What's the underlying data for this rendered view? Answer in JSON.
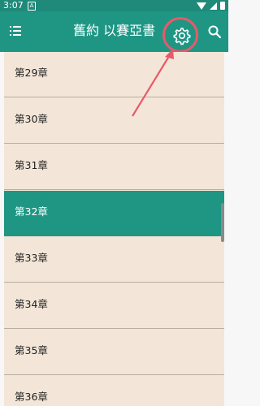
{
  "status_bar": {
    "time": "3:07",
    "notif_letter": "A"
  },
  "app_bar": {
    "title": "舊約 以賽亞書",
    "menu_icon": "menu-icon",
    "settings_icon": "gear-icon",
    "search_icon": "search-icon"
  },
  "chapters": [
    {
      "label": "第29章",
      "selected": false
    },
    {
      "label": "第30章",
      "selected": false
    },
    {
      "label": "第31章",
      "selected": false
    },
    {
      "label": "第32章",
      "selected": true
    },
    {
      "label": "第33章",
      "selected": false
    },
    {
      "label": "第34章",
      "selected": false
    },
    {
      "label": "第35章",
      "selected": false
    },
    {
      "label": "第36章",
      "selected": false
    }
  ],
  "colors": {
    "accent": "#1f9684",
    "list_background": "#f3e6d8",
    "highlight": "#e85a6a"
  }
}
